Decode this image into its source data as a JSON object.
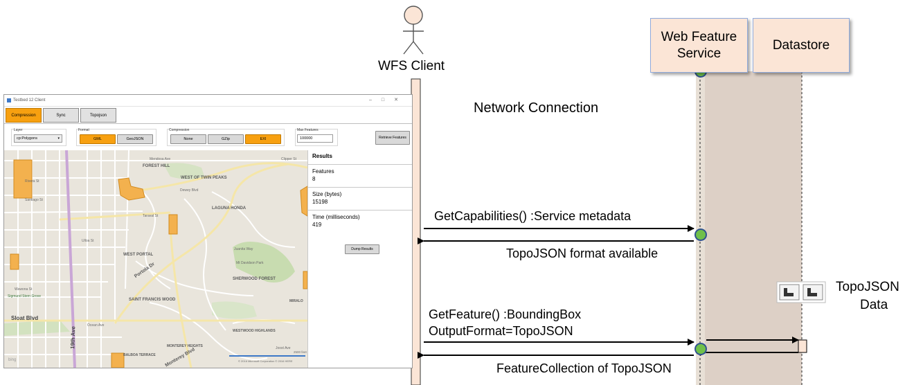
{
  "actors": {
    "client_label": "WFS Client"
  },
  "lifelines": {
    "wfs_label": "Web Feature Service",
    "datastore_label": "Datastore"
  },
  "network_label": "Network Connection",
  "messages": {
    "m1": "GetCapabilities() :Service metadata",
    "m2": "TopoJSON format available",
    "m3_line1": "GetFeature() :BoundingBox",
    "m3_line2": "OutputFormat=TopoJSON",
    "m4": "FeatureCollection of TopoJSON"
  },
  "data_note": {
    "line1": "TopoJSON",
    "line2": "Data"
  },
  "app": {
    "window_title": "Testbed 12 Client",
    "tabs": [
      "Compression",
      "Sync",
      "Topojson"
    ],
    "layer_label": "Layer",
    "layer_value": "cp:Polygons",
    "format_label": "Format",
    "format_options": [
      "GML",
      "GeoJSON"
    ],
    "compression_label": "Compression",
    "compression_options": [
      "None",
      "GZip",
      "EXI"
    ],
    "max_features_label": "Max Features",
    "max_features_value": "100000",
    "retrieve_button": "Retrieve Features",
    "results": {
      "title": "Results",
      "features_label": "Features",
      "features_value": "8",
      "size_label": "Size (bytes)",
      "size_value": "15198",
      "time_label": "Time (milliseconds)",
      "time_value": "419",
      "dump_button": "Dump Results"
    },
    "map": {
      "scale_label": "2500 feet",
      "copyright": "© 2016 Microsoft Corporation   © 2016 HERE",
      "bing": "bing",
      "places": [
        "FOREST HILL",
        "WEST OF TWIN PEAKS",
        "LAGUNA HONDA",
        "WEST PORTAL",
        "Mt Davidson Park",
        "SHERWOOD FOREST",
        "SAINT FRANCIS WOOD",
        "Sigmund Stern Grove",
        "Sloat Blvd",
        "19th Ave",
        "Portola Dr",
        "Taraval St",
        "Ulloa St",
        "Santiago St",
        "Rivera St",
        "Wawona St",
        "WESTWOOD HIGHLANDS",
        "MONTEREY HEIGHTS",
        "BALBOA TERRACE",
        "Monterey Blvd",
        "MIRALO",
        "Joost Ave",
        "Juanita Way",
        "Mendosa Ave",
        "Clipper St",
        "Dewey Blvd",
        "Ocean Ave"
      ]
    }
  }
}
